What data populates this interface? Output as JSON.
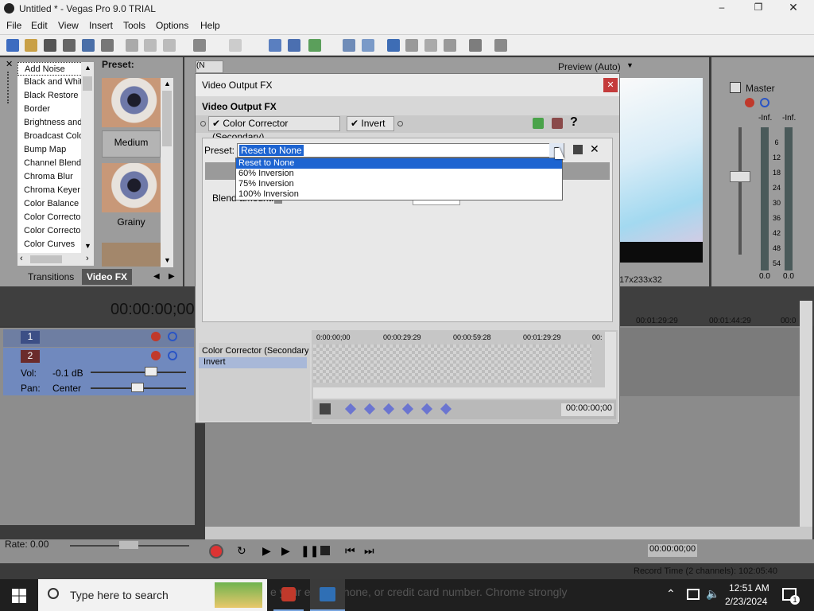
{
  "window": {
    "title": "Untitled * - Vegas Pro 9.0 TRIAL"
  },
  "menu": [
    "File",
    "Edit",
    "View",
    "Insert",
    "Tools",
    "Options",
    "Help"
  ],
  "fx_panel": {
    "preset_label": "Preset:",
    "items": [
      "Add Noise",
      "Black and White",
      "Black Restore",
      "Border",
      "Brightness and",
      "Broadcast Colo",
      "Bump Map",
      "Channel Blend",
      "Chroma Blur",
      "Chroma Keyer",
      "Color Balance",
      "Color Correcto",
      "Color Correcto",
      "Color Curves"
    ],
    "thumbs": [
      "Medium",
      "Grainy"
    ],
    "tabs": [
      "Transitions",
      "Video FX"
    ]
  },
  "preview": {
    "label": "Preview (Auto)",
    "resolution": "17x233x32"
  },
  "master": {
    "label": "Master",
    "left_db": "-Inf.",
    "right_db": "-Inf.",
    "scale": [
      "6",
      "12",
      "18",
      "24",
      "30",
      "36",
      "42",
      "48",
      "54"
    ],
    "left_val": "0.0",
    "right_val": "0.0"
  },
  "dialog": {
    "title": "Video Output FX",
    "subtitle": "Video Output FX",
    "chain": [
      "Color Corrector (Secondary)",
      "Invert"
    ],
    "preset_label": "Preset:",
    "preset_value": "Reset to None",
    "blend_label": "Blend amount:",
    "blend_value": "0.000",
    "dropdown": [
      "Reset to None",
      "60% Inversion",
      "75% Inversion",
      "100% Inversion"
    ],
    "kf_tracks": [
      "Color Corrector (Secondary",
      "Invert"
    ],
    "kf_ticks": [
      "0:00:00;00",
      "00:00:29:29",
      "00:00:59:28",
      "00:01:29:29",
      "00:"
    ],
    "kf_time": "00:00:00;00"
  },
  "timeline": {
    "time": "00:00:00;00",
    "ruler": [
      "00:01:29:29",
      "00:01:44:29",
      "00:0"
    ],
    "track1": "1",
    "track2": "2",
    "vol_label": "Vol:",
    "vol_value": "-0.1 dB",
    "pan_label": "Pan:",
    "pan_value": "Center"
  },
  "transport": {
    "rate_label": "Rate: 0.00",
    "time": "00:00:00;00"
  },
  "status": {
    "record_time": "Record Time (2 channels): 102:05:40"
  },
  "taskbar": {
    "search": "Type here to search",
    "ghost": "e your email, phone, or credit card number. Chrome strongly",
    "time": "12:51 AM",
    "date": "2/23/2024",
    "notif": "1"
  }
}
